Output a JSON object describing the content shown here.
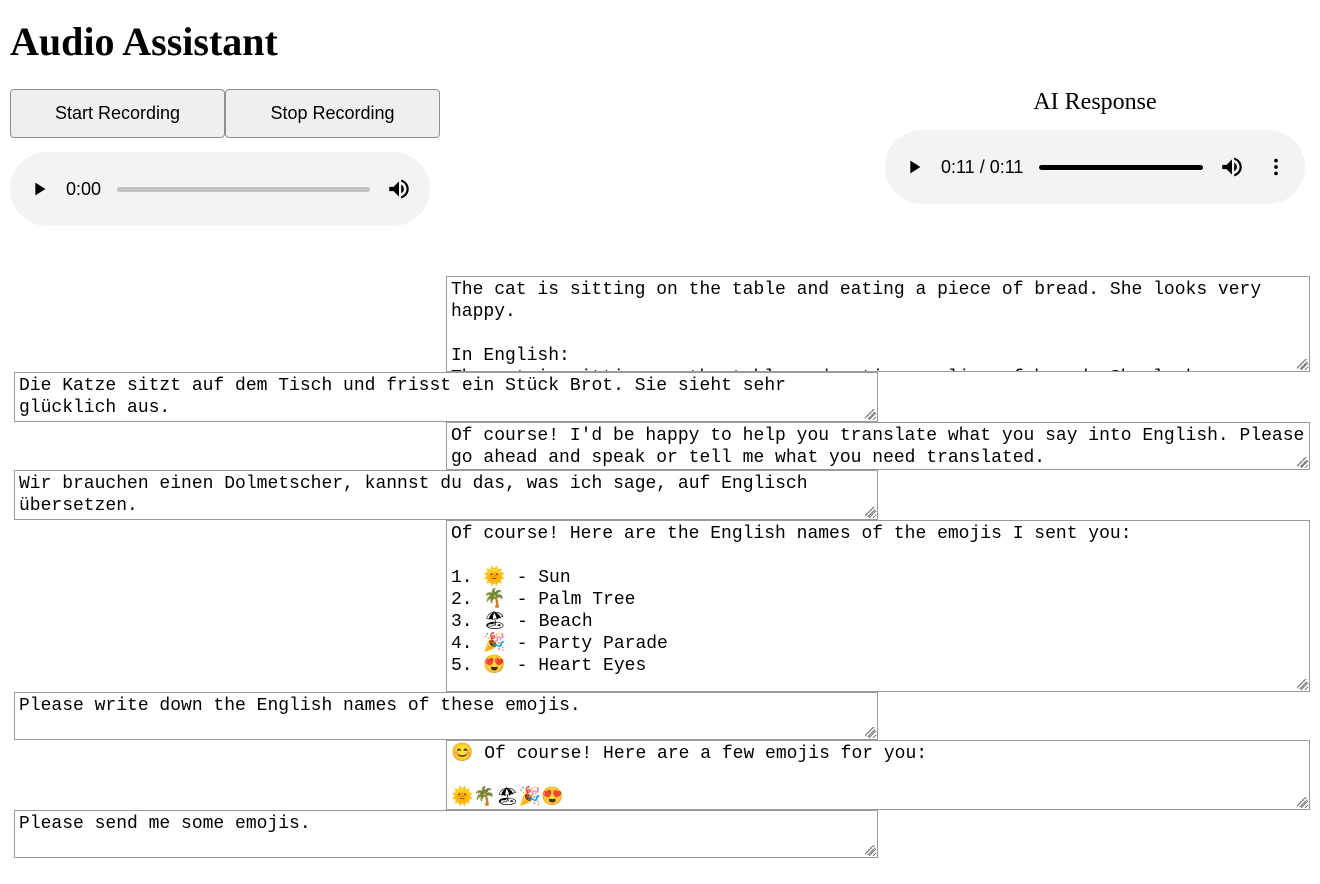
{
  "title": "Audio Assistant",
  "buttons": {
    "start": "Start Recording",
    "stop": "Stop Recording"
  },
  "ai_response_label": "AI Response",
  "players": {
    "left": {
      "time": "0:00"
    },
    "right": {
      "time": "0:11 / 0:11"
    }
  },
  "messages": [
    {
      "role": "assistant",
      "text": "The cat is sitting on the table and eating a piece of bread. She looks very happy.\n\nIn English:\nThe cat is sitting on the table and eating a slice of bread. She looks very happy."
    },
    {
      "role": "user",
      "text": "Die Katze sitzt auf dem Tisch und frisst ein Stück Brot. Sie sieht sehr glücklich aus."
    },
    {
      "role": "assistant",
      "text": "Of course! I'd be happy to help you translate what you say into English. Please go ahead and speak or tell me what you need translated."
    },
    {
      "role": "user",
      "text": "Wir brauchen einen Dolmetscher, kannst du das, was ich sage, auf Englisch übersetzen."
    },
    {
      "role": "assistant",
      "text": "Of course! Here are the English names of the emojis I sent you:\n\n1. 🌞 - Sun\n2. 🌴 - Palm Tree\n3. 🏖 - Beach\n4. 🎉 - Party Parade\n5. 😍 - Heart Eyes"
    },
    {
      "role": "user",
      "text": "Please write down the English names of these emojis."
    },
    {
      "role": "assistant",
      "text": "😊 Of course! Here are a few emojis for you:\n\n🌞🌴🏖🎉😍"
    },
    {
      "role": "user",
      "text": "Please send me some emojis."
    }
  ]
}
